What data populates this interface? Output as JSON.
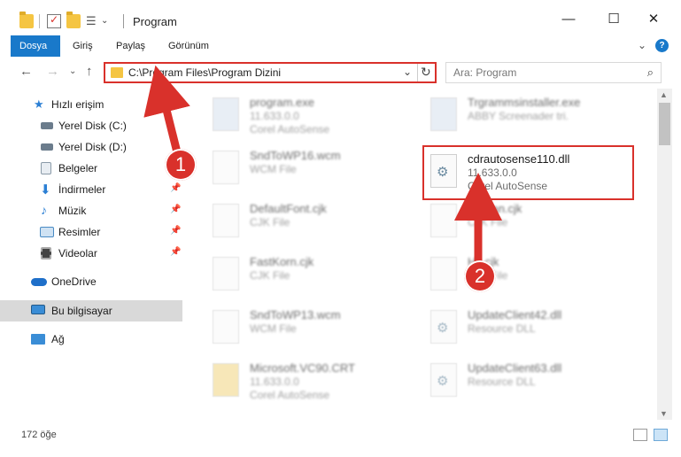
{
  "window": {
    "title": "Program",
    "minimize": "—",
    "maximize": "☐",
    "close": "✕"
  },
  "ribbon": {
    "tabs": [
      {
        "label": "Dosya"
      },
      {
        "label": "Giriş"
      },
      {
        "label": "Paylaş"
      },
      {
        "label": "Görünüm"
      }
    ],
    "collapse": "⌄",
    "help": "?"
  },
  "nav": {
    "back": "←",
    "forward": "→",
    "recent": "⌄",
    "up": "↑",
    "address": "C:\\Program Files\\Program Dizini",
    "dropdown": "⌄",
    "refresh": "↻",
    "search_placeholder": "Ara: Program",
    "search_icon": "⌕"
  },
  "sidebar": {
    "items": [
      {
        "label": "Hızlı erişim",
        "icon": "star-icon",
        "color": "#2b7fd4"
      },
      {
        "label": "Yerel Disk (C:)",
        "icon": "drive-icon",
        "color": "#6b7c8c"
      },
      {
        "label": "Yerel Disk (D:)",
        "icon": "drive-icon",
        "color": "#6b7c8c"
      },
      {
        "label": "Belgeler",
        "icon": "documents-icon",
        "color": "#8a9aa8",
        "pinned": "📌"
      },
      {
        "label": "İndirmeler",
        "icon": "download-icon",
        "color": "#2b7fd4",
        "pinned": "📌"
      },
      {
        "label": "Müzik",
        "icon": "music-icon",
        "color": "#2b7fd4",
        "pinned": "📌"
      },
      {
        "label": "Resimler",
        "icon": "pictures-icon",
        "color": "#4a8bc4",
        "pinned": "📌"
      },
      {
        "label": "Videolar",
        "icon": "videos-icon",
        "color": "#444",
        "pinned": "📌"
      },
      {
        "label": "OneDrive",
        "icon": "cloud-icon",
        "color": "#1e6fc9"
      },
      {
        "label": "Bu bilgisayar",
        "icon": "computer-icon",
        "color": "#3a8dd6"
      },
      {
        "label": "Ağ",
        "icon": "network-icon",
        "color": "#3a8dd6"
      }
    ]
  },
  "files": [
    {
      "name": "program.exe",
      "sub1": "11.633.0.0",
      "sub2": "Corel AutoSense",
      "icon": "exe"
    },
    {
      "name": "Trgrammsinstaller.exe",
      "sub1": "ABBY Screenader tri.",
      "sub2": "",
      "icon": "exe"
    },
    {
      "name": "SndToWP16.wcm",
      "sub1": "WCM File",
      "sub2": "",
      "icon": "blank"
    },
    {
      "name": "cdrautosense110.dll",
      "sub1": "11.633.0.0",
      "sub2": "Corel AutoSense",
      "icon": "gear"
    },
    {
      "name": "DefaultFont.cjk",
      "sub1": "CJK File",
      "sub2": "",
      "icon": "blank"
    },
    {
      "name": "Korean.cjk",
      "sub1": "CJK File",
      "sub2": "",
      "icon": "blank"
    },
    {
      "name": "FastKorn.cjk",
      "sub1": "CJK File",
      "sub2": "",
      "icon": "blank"
    },
    {
      "name": "Hk.cjk",
      "sub1": "CJK File",
      "sub2": "",
      "icon": "blank"
    },
    {
      "name": "SndToWP13.wcm",
      "sub1": "WCM File",
      "sub2": "",
      "icon": "blank"
    },
    {
      "name": "UpdateClient42.dll",
      "sub1": "Resource DLL",
      "sub2": "",
      "icon": "gear"
    },
    {
      "name": "Microsoft.VC90.CRT",
      "sub1": "11.633.0.0",
      "sub2": "Corel AutoSense",
      "icon": "zip"
    },
    {
      "name": "UpdateClient63.dll",
      "sub1": "Resource DLL",
      "sub2": "",
      "icon": "gear"
    }
  ],
  "status": {
    "count": "172 öğe"
  },
  "callouts": {
    "one": "1",
    "two": "2"
  }
}
